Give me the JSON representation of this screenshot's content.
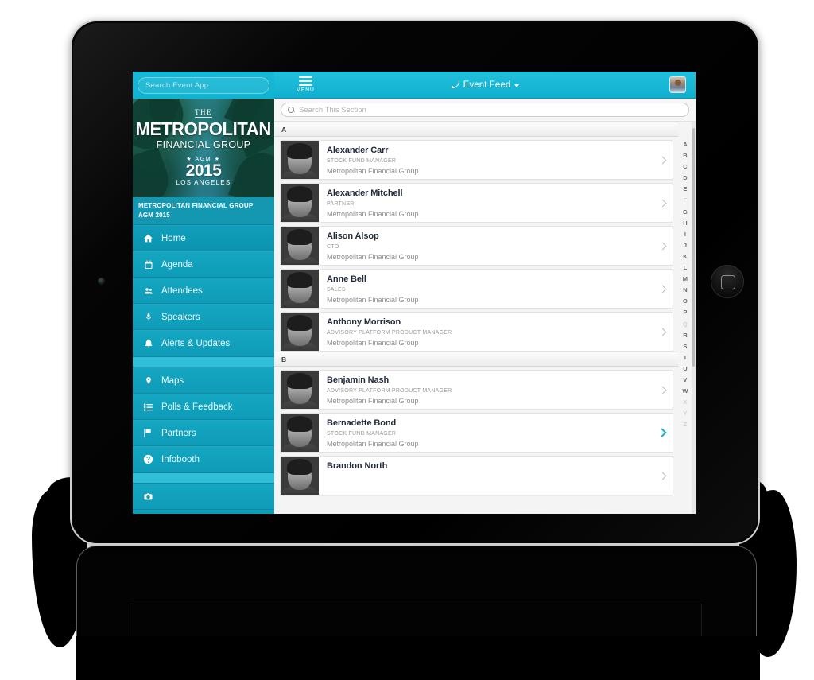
{
  "app": {
    "top_search_placeholder": "Search Event App",
    "menu_label": "MENU",
    "feed_title": "Event Feed",
    "menu_icon": "hamburger-icon",
    "feed_icon": "rss-icon",
    "caret_icon": "chevron-down-icon",
    "avatar_icon": "user-avatar"
  },
  "event": {
    "hero_the": "THE",
    "hero_name_line1": "METROPOLITAN",
    "hero_name_line2": "FINANCIAL GROUP",
    "hero_agm": "★ AGM ★",
    "hero_year": "2015",
    "hero_city": "LOS ANGELES",
    "caption": "METROPOLITAN FINANCIAL GROUP AGM 2015"
  },
  "sidebar": {
    "items": [
      {
        "label": "Home",
        "icon": "home-icon",
        "name": "home",
        "active": true,
        "gap_after": false
      },
      {
        "label": "Agenda",
        "icon": "calendar-icon",
        "name": "agenda",
        "active": false,
        "gap_after": false
      },
      {
        "label": "Attendees",
        "icon": "people-icon",
        "name": "attendees",
        "active": false,
        "gap_after": false
      },
      {
        "label": "Speakers",
        "icon": "mic-icon",
        "name": "speakers",
        "active": false,
        "gap_after": false
      },
      {
        "label": "Alerts & Updates",
        "icon": "bell-icon",
        "name": "alerts",
        "active": false,
        "gap_after": true
      },
      {
        "label": "Maps",
        "icon": "pin-icon",
        "name": "maps",
        "active": false,
        "gap_after": false
      },
      {
        "label": "Polls & Feedback",
        "icon": "list-icon",
        "name": "polls",
        "active": false,
        "gap_after": false
      },
      {
        "label": "Partners",
        "icon": "flag-icon",
        "name": "partners",
        "active": false,
        "gap_after": false
      },
      {
        "label": "Infobooth",
        "icon": "question-icon",
        "name": "infobooth",
        "active": false,
        "gap_after": true
      },
      {
        "label": "",
        "icon": "camera-icon",
        "name": "cut-off",
        "active": false,
        "gap_after": false
      }
    ]
  },
  "content": {
    "search_placeholder": "Search This Section",
    "search_icon": "search-icon",
    "sections": [
      {
        "letter": "A",
        "people": [
          {
            "name": "Alexander Carr",
            "role": "STOCK FUND MANAGER",
            "org": "Metropolitan Financial Group",
            "highlight": false
          },
          {
            "name": "Alexander Mitchell",
            "role": "PARTNER",
            "org": "Metropolitan Financial Group",
            "highlight": false
          },
          {
            "name": "Alison Alsop",
            "role": "CTO",
            "org": "Metropolitan Financial Group",
            "highlight": false
          },
          {
            "name": "Anne Bell",
            "role": "SALES",
            "org": "Metropolitan Financial Group",
            "highlight": false
          },
          {
            "name": "Anthony Morrison",
            "role": "ADVISORY PLATFORM PRODUCT MANAGER",
            "org": "Metropolitan Financial Group",
            "highlight": false
          }
        ]
      },
      {
        "letter": "B",
        "people": [
          {
            "name": "Benjamin Nash",
            "role": "ADVISORY PLATFORM PRODUCT MANAGER",
            "org": "Metropolitan Financial Group",
            "highlight": false
          },
          {
            "name": "Bernadette Bond",
            "role": "STOCK FUND MANAGER",
            "org": "Metropolitan Financial Group",
            "highlight": true
          },
          {
            "name": "Brandon North",
            "role": "",
            "org": "",
            "highlight": false
          }
        ]
      }
    ],
    "alpha_index": [
      {
        "letter": "A",
        "enabled": true
      },
      {
        "letter": "B",
        "enabled": true
      },
      {
        "letter": "C",
        "enabled": true
      },
      {
        "letter": "D",
        "enabled": true
      },
      {
        "letter": "E",
        "enabled": true
      },
      {
        "letter": "F",
        "enabled": false
      },
      {
        "letter": "G",
        "enabled": true
      },
      {
        "letter": "H",
        "enabled": true
      },
      {
        "letter": "I",
        "enabled": true
      },
      {
        "letter": "J",
        "enabled": true
      },
      {
        "letter": "K",
        "enabled": true
      },
      {
        "letter": "L",
        "enabled": true
      },
      {
        "letter": "M",
        "enabled": true
      },
      {
        "letter": "N",
        "enabled": true
      },
      {
        "letter": "O",
        "enabled": true
      },
      {
        "letter": "P",
        "enabled": true
      },
      {
        "letter": "Q",
        "enabled": false
      },
      {
        "letter": "R",
        "enabled": true
      },
      {
        "letter": "S",
        "enabled": true
      },
      {
        "letter": "T",
        "enabled": true
      },
      {
        "letter": "U",
        "enabled": true
      },
      {
        "letter": "V",
        "enabled": true
      },
      {
        "letter": "W",
        "enabled": true
      },
      {
        "letter": "X",
        "enabled": false
      },
      {
        "letter": "Y",
        "enabled": false
      },
      {
        "letter": "Z",
        "enabled": false
      }
    ]
  },
  "colors": {
    "brand_cyan": "#0fb0cf",
    "sidebar_cyan": "#0f9cb8",
    "accent_chevron": "#10b0c9",
    "caption_bg": "#1498b2",
    "name_text": "#232b3a"
  }
}
